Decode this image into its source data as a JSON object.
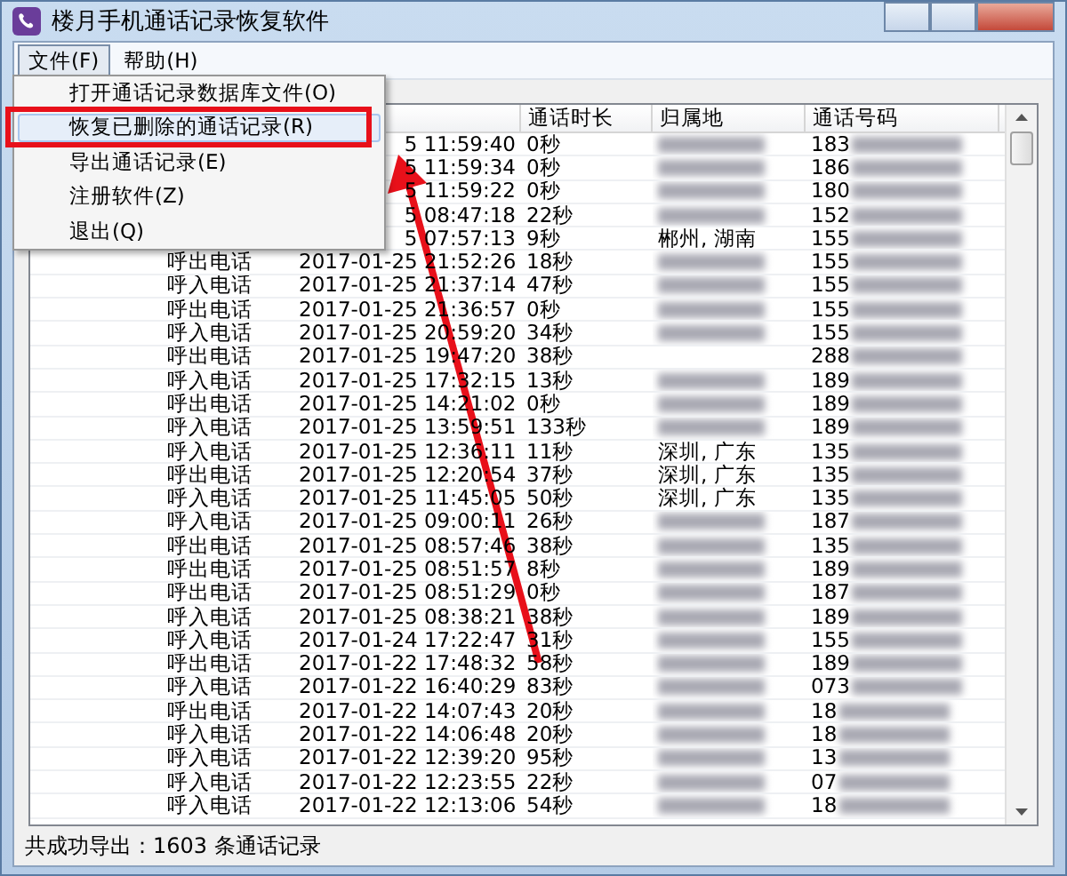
{
  "window": {
    "title": "楼月手机通话记录恢复软件"
  },
  "menubar": [
    {
      "label": "文件(F)",
      "selected": true
    },
    {
      "label": "帮助(H)",
      "selected": false
    }
  ],
  "menu": {
    "items": [
      {
        "label": "打开通话记录数据库文件(O)",
        "selected": false
      },
      {
        "label": "恢复已删除的通话记录(R)",
        "selected": true
      },
      {
        "label": "导出通话记录(E)",
        "selected": false
      },
      {
        "label": "注册软件(Z)",
        "selected": false
      },
      {
        "label": "退出(Q)",
        "selected": false
      }
    ]
  },
  "table": {
    "columns": [
      {
        "label": "通话时长"
      },
      {
        "label": "归属地"
      },
      {
        "label": "通话号码"
      }
    ],
    "rows": [
      {
        "time": "5 11:59:40",
        "duration": "0秒",
        "blurred": true,
        "number": "183"
      },
      {
        "time": "5 11:59:34",
        "duration": "0秒",
        "blurred": true,
        "number": "186"
      },
      {
        "time": "5 11:59:22",
        "duration": "0秒",
        "blurred": true,
        "number": "180"
      },
      {
        "time": "5 08:47:18",
        "duration": "22秒",
        "blurred": true,
        "number": "152"
      },
      {
        "time": "5 07:57:13",
        "duration": "9秒",
        "location": "郴州, 湖南",
        "blurred": false,
        "number": "155"
      },
      {
        "type": "呼出电话",
        "time": "2017-01-25 21:52:26",
        "duration": "18秒",
        "blurred": true,
        "number": "155"
      },
      {
        "type": "呼入电话",
        "time": "2017-01-25 21:37:14",
        "duration": "47秒",
        "blurred": true,
        "number": "155"
      },
      {
        "type": "呼出电话",
        "time": "2017-01-25 21:36:57",
        "duration": "0秒",
        "blurred": true,
        "number": "155"
      },
      {
        "type": "呼入电话",
        "time": "2017-01-25 20:59:20",
        "duration": "34秒",
        "blurred": true,
        "number": "155"
      },
      {
        "type": "呼出电话",
        "time": "2017-01-25 19:47:20",
        "duration": "38秒",
        "blurred": false,
        "number": "288"
      },
      {
        "type": "呼入电话",
        "time": "2017-01-25 17:32:15",
        "duration": "13秒",
        "blurred": true,
        "number": "189"
      },
      {
        "type": "呼出电话",
        "time": "2017-01-25 14:21:02",
        "duration": "0秒",
        "blurred": true,
        "number": "189"
      },
      {
        "type": "呼入电话",
        "time": "2017-01-25 13:59:51",
        "duration": "133秒",
        "blurred": true,
        "number": "189"
      },
      {
        "type": "呼入电话",
        "time": "2017-01-25 12:36:11",
        "duration": "11秒",
        "location": "深圳, 广东",
        "blurred": false,
        "number": "135"
      },
      {
        "type": "呼出电话",
        "time": "2017-01-25 12:20:54",
        "duration": "37秒",
        "location": "深圳, 广东",
        "blurred": false,
        "number": "135"
      },
      {
        "type": "呼入电话",
        "time": "2017-01-25 11:45:05",
        "duration": "50秒",
        "location": "深圳, 广东",
        "blurred": false,
        "number": "135"
      },
      {
        "type": "呼入电话",
        "time": "2017-01-25 09:00:11",
        "duration": "26秒",
        "blurred": true,
        "number": "187"
      },
      {
        "type": "呼出电话",
        "time": "2017-01-25 08:57:46",
        "duration": "38秒",
        "blurred": true,
        "number": "135"
      },
      {
        "type": "呼出电话",
        "time": "2017-01-25 08:51:57",
        "duration": "8秒",
        "blurred": true,
        "number": "189"
      },
      {
        "type": "呼出电话",
        "time": "2017-01-25 08:51:29",
        "duration": "0秒",
        "blurred": true,
        "number": "187"
      },
      {
        "type": "呼入电话",
        "time": "2017-01-25 08:38:21",
        "duration": "38秒",
        "blurred": true,
        "number": "189"
      },
      {
        "type": "呼入电话",
        "time": "2017-01-24 17:22:47",
        "duration": "31秒",
        "blurred": true,
        "number": "155"
      },
      {
        "type": "呼出电话",
        "time": "2017-01-22 17:48:32",
        "duration": "58秒",
        "blurred": true,
        "number": "189"
      },
      {
        "type": "呼入电话",
        "time": "2017-01-22 16:40:29",
        "duration": "83秒",
        "blurred": true,
        "number": "073"
      },
      {
        "type": "呼出电话",
        "time": "2017-01-22 14:07:43",
        "duration": "20秒",
        "blurred": true,
        "number": "18"
      },
      {
        "type": "呼入电话",
        "time": "2017-01-22 14:06:48",
        "duration": "20秒",
        "blurred": true,
        "number": "18"
      },
      {
        "type": "呼入电话",
        "time": "2017-01-22 12:39:20",
        "duration": "95秒",
        "blurred": true,
        "number": "13"
      },
      {
        "type": "呼入电话",
        "time": "2017-01-22 12:23:55",
        "duration": "22秒",
        "blurred": true,
        "number": "07"
      },
      {
        "type": "呼入电话",
        "time": "2017-01-22 12:13:06",
        "duration": "54秒",
        "blurred": true,
        "number": "18"
      }
    ]
  },
  "status_bar": "共成功导出：1603 条通话记录"
}
